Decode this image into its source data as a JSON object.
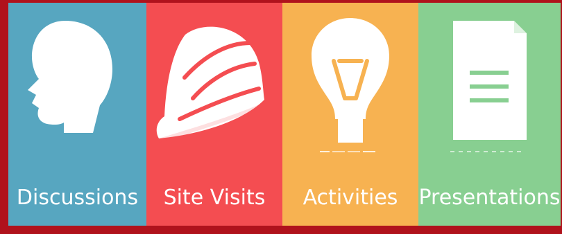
{
  "tiles": [
    {
      "label": "Discussions",
      "icon": "head-icon",
      "color": "#57a6c0"
    },
    {
      "label": "Site Visits",
      "icon": "hard-hat-icon",
      "color": "#f44d51"
    },
    {
      "label": "Activities",
      "icon": "lightbulb-icon",
      "color": "#f7b251"
    },
    {
      "label": "Presentations",
      "icon": "document-icon",
      "color": "#88cf91"
    }
  ],
  "colors": {
    "frame": "#b0121c",
    "icon": "#ffffff"
  }
}
